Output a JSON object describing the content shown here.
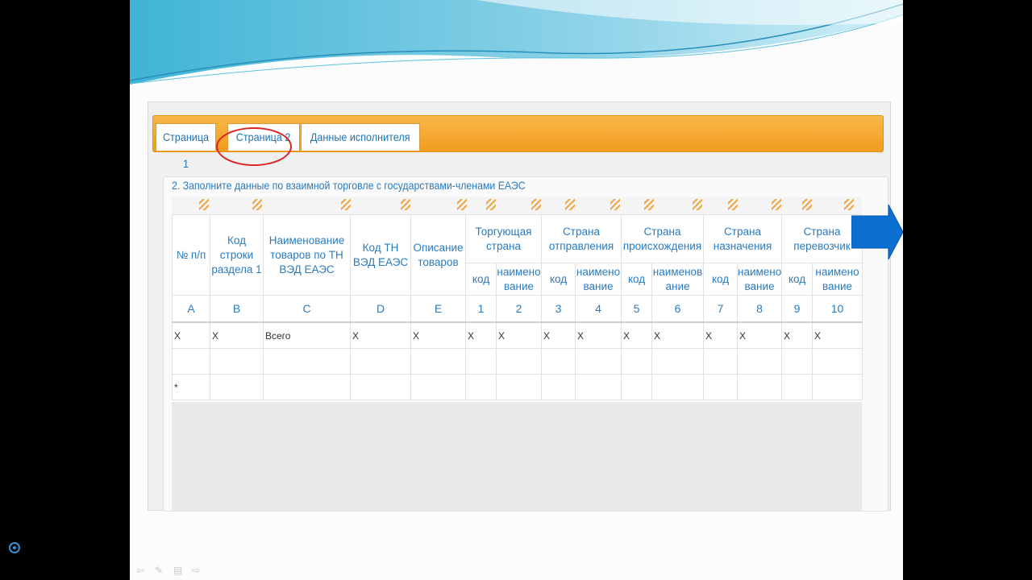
{
  "tabs": [
    {
      "label": "Страница 1"
    },
    {
      "label": "Страница 2"
    },
    {
      "label": "Данные исполнителя"
    }
  ],
  "section_title": "2. Заполните данные по взаимной торговле с государствами-членами ЕАЭС",
  "table": {
    "headers": {
      "num": "№ п/п",
      "row_code": "Код строки раздела 1",
      "goods_name": "Наименование товаров по ТН ВЭД ЕАЭС",
      "hs_code": "Код ТН ВЭД ЕАЭС",
      "description": "Описание товаров",
      "trading_country": "Торгующая страна",
      "dispatch_country": "Страна отправления",
      "origin_country": "Страна происхождения",
      "destination_country": "Страна назначения",
      "carrier_country": "Страна перевозчик",
      "sub_code": "код",
      "sub_name_a": "наимено вание",
      "sub_name_b": "наименов ание"
    },
    "letters": [
      "A",
      "B",
      "C",
      "D",
      "E",
      "1",
      "2",
      "3",
      "4",
      "5",
      "6",
      "7",
      "8",
      "9",
      "10"
    ],
    "rows": [
      [
        "X",
        "X",
        "Всего",
        "X",
        "X",
        "X",
        "X",
        "X",
        "X",
        "X",
        "X",
        "X",
        "X",
        "X",
        "X"
      ],
      [
        "",
        "",
        "",
        "",
        "",
        "",
        "",
        "",
        "",
        "",
        "",
        "",
        "",
        "",
        ""
      ],
      [
        "*",
        "",
        "",
        "",
        "",
        "",
        "",
        "",
        "",
        "",
        "",
        "",
        "",
        "",
        ""
      ]
    ]
  },
  "colors": {
    "tab_bar": "#f5a623",
    "accent_blue": "#2a7bbf",
    "annotation_red": "#dd2222",
    "arrow_blue": "#0b6fd1"
  },
  "icons": [
    "arrow-left-icon",
    "pen-icon",
    "menu-icon",
    "arrow-right-icon",
    "next-arrow-icon"
  ]
}
